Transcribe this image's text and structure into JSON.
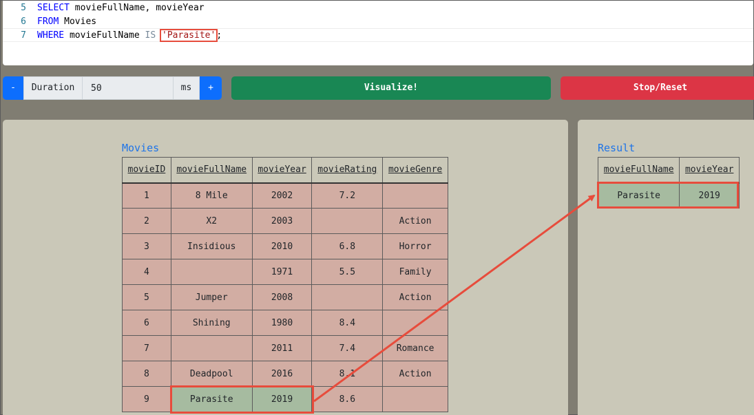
{
  "editor": {
    "lines": [
      {
        "num": "5",
        "kw1": "SELECT",
        "rest": " movieFullName, movieYear"
      },
      {
        "num": "6",
        "kw1": "FROM",
        "rest": " Movies"
      },
      {
        "num": "7",
        "kw1": "WHERE",
        "ident": " movieFullName ",
        "op": "IS",
        "str": "'Parasite'",
        "end": ";"
      }
    ]
  },
  "controls": {
    "minus": "-",
    "duration_label": "Duration",
    "duration_value": "50",
    "unit": "ms",
    "plus": "+",
    "visualize": "Visualize!",
    "stop": "Stop/Reset"
  },
  "movies": {
    "title": "Movies",
    "headers": [
      "movieID",
      "movieFullName",
      "movieYear",
      "movieRating",
      "movieGenre"
    ],
    "rows": [
      [
        "1",
        "8 Mile",
        "2002",
        "7.2",
        ""
      ],
      [
        "2",
        "X2",
        "2003",
        "",
        "Action"
      ],
      [
        "3",
        "Insidious",
        "2010",
        "6.8",
        "Horror"
      ],
      [
        "4",
        "",
        "1971",
        "5.5",
        "Family"
      ],
      [
        "5",
        "Jumper",
        "2008",
        "",
        "Action"
      ],
      [
        "6",
        "Shining",
        "1980",
        "8.4",
        ""
      ],
      [
        "7",
        "",
        "2011",
        "7.4",
        "Romance"
      ],
      [
        "8",
        "Deadpool",
        "2016",
        "8.1",
        "Action"
      ],
      [
        "9",
        "Parasite",
        "2019",
        "8.6",
        ""
      ]
    ]
  },
  "result": {
    "title": "Result",
    "headers": [
      "movieFullName",
      "movieYear"
    ],
    "rows": [
      [
        "Parasite",
        "2019"
      ]
    ]
  },
  "colors": {
    "highlight": "#e74c3c",
    "row_match": "#a6bba0",
    "row_default": "#d2ada3"
  }
}
